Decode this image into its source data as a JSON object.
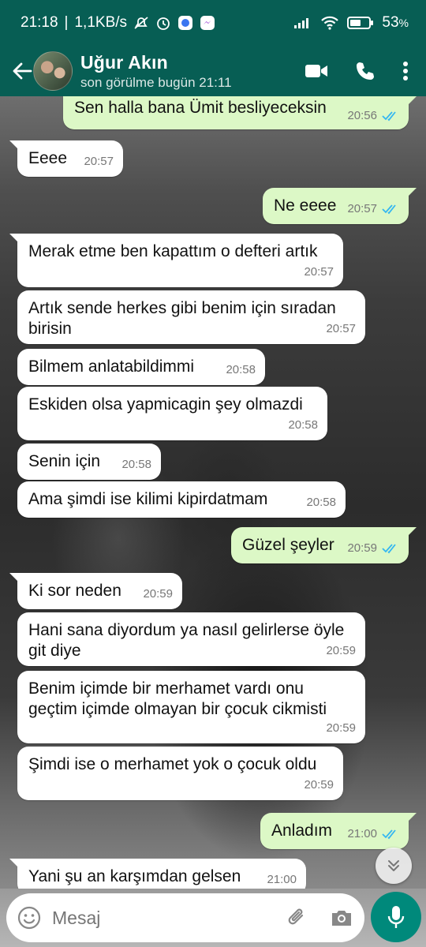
{
  "status_bar": {
    "time": "21:18",
    "speed": "1,1KB/s",
    "battery": "53",
    "icons": [
      "mute-icon",
      "alarm-icon",
      "signal-app-icon",
      "messenger-icon",
      "signal-icon",
      "wifi-icon",
      "battery-icon"
    ]
  },
  "header": {
    "contact_name": "Uğur Akın",
    "last_seen": "son görülme bugün 21:11",
    "colors": {
      "header_bg": "#075e54",
      "bubble_out": "#dcf8c6",
      "tick_read": "#34b7f1",
      "accent": "#00897b"
    }
  },
  "messages": [
    {
      "dir": "out",
      "text": "Sen halla bana Ümit besliyeceksin",
      "time": "20:56",
      "read": true
    },
    {
      "dir": "in",
      "text": "Eeee",
      "time": "20:57"
    },
    {
      "dir": "out",
      "text": "Ne eeee",
      "time": "20:57",
      "read": true
    },
    {
      "dir": "in",
      "text": "Merak etme ben kapattım o defteri artık",
      "time": "20:57"
    },
    {
      "dir": "in",
      "text": "Artık sende herkes gibi benim için sıradan birisin",
      "time": "20:57"
    },
    {
      "dir": "in",
      "text": "Bilmem anlatabildimmi",
      "time": "20:58"
    },
    {
      "dir": "in",
      "text": "Eskiden olsa yapmicagin şey olmazdi",
      "time": "20:58"
    },
    {
      "dir": "in",
      "text": "Senin için",
      "time": "20:58"
    },
    {
      "dir": "in",
      "text": "Ama şimdi ise kilimi kipirdatmam",
      "time": "20:58"
    },
    {
      "dir": "out",
      "text": "Güzel şeyler",
      "time": "20:59",
      "read": true
    },
    {
      "dir": "in",
      "text": "Ki sor neden",
      "time": "20:59"
    },
    {
      "dir": "in",
      "text": "Hani sana diyordum ya nasıl gelirlerse öyle git diye",
      "time": "20:59"
    },
    {
      "dir": "in",
      "text": "Benim içimde bir merhamet vardı onu geçtim içimde olmayan bir çocuk cikmisti",
      "time": "20:59"
    },
    {
      "dir": "in",
      "text": "Şimdi ise o merhamet yok o çocuk oldu",
      "time": "20:59"
    },
    {
      "dir": "out",
      "text": "Anladım",
      "time": "21:00",
      "read": true
    },
    {
      "dir": "in",
      "text": "Yani şu an karşımdan gelsen",
      "time": "21:00"
    }
  ],
  "composer": {
    "placeholder": "Mesaj"
  }
}
